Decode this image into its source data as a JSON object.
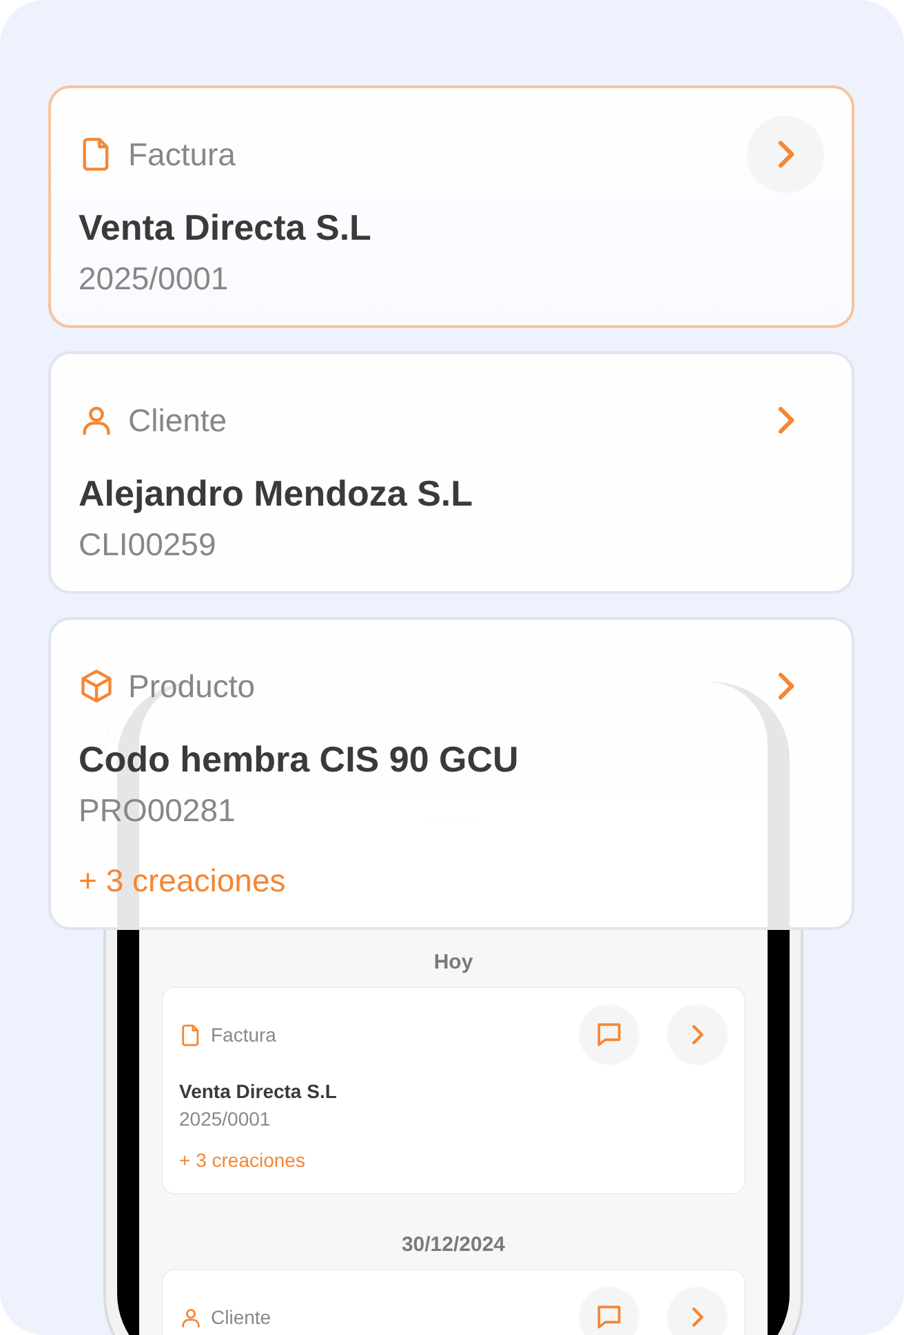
{
  "cards": [
    {
      "kind": "invoice",
      "type_label": "Factura",
      "title": "Venta Directa S.L",
      "code": "2025/0001",
      "selected": true
    },
    {
      "kind": "client",
      "type_label": "Cliente",
      "title": "Alejandro Mendoza S.L",
      "code": "CLI00259",
      "selected": false
    },
    {
      "kind": "product",
      "type_label": "Producto",
      "title": "Codo hembra CIS 90 GCU",
      "code": "PRO00281",
      "more": "+ 3 creaciones",
      "selected": false
    }
  ],
  "phone": {
    "groups": [
      {
        "date": "Hoy",
        "items": [
          {
            "kind": "invoice",
            "type_label": "Factura",
            "title": "Venta Directa S.L",
            "code": "2025/0001",
            "more": "+ 3 creaciones"
          }
        ]
      },
      {
        "date": "30/12/2024",
        "items": [
          {
            "kind": "client",
            "type_label": "Cliente"
          }
        ]
      }
    ]
  }
}
